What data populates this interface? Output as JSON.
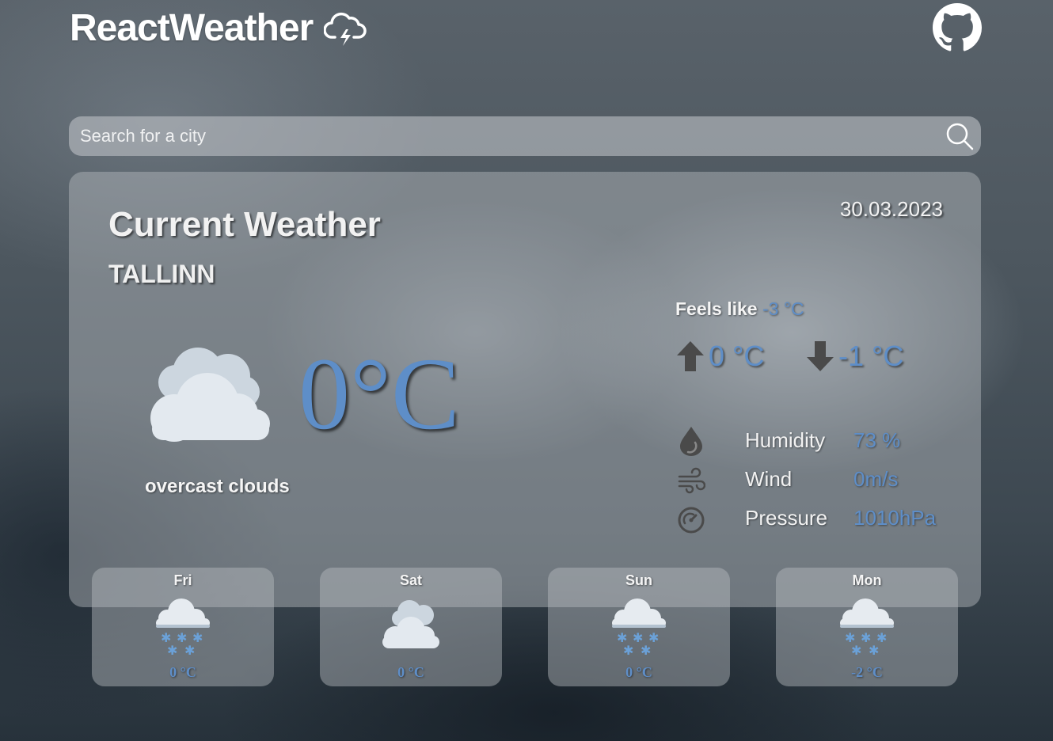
{
  "header": {
    "title": "ReactWeather",
    "logo_icon": "cloud-lightning-icon",
    "github_icon": "github-icon"
  },
  "search": {
    "placeholder": "Search for a city",
    "value": ""
  },
  "current": {
    "heading": "Current Weather",
    "date": "30.03.2023",
    "city": "TALLINN",
    "temperature": "0°C",
    "description": "overcast clouds",
    "icon": "overcast-clouds-icon",
    "feels_like_label": "Feels like",
    "feels_like_value": "-3 °C",
    "temp_max": "0 °C",
    "temp_min": "-1 °C",
    "details": [
      {
        "icon": "humidity-drop-icon",
        "label": "Humidity",
        "value": "73 %"
      },
      {
        "icon": "wind-icon",
        "label": "Wind",
        "value": "0m/s"
      },
      {
        "icon": "pressure-gauge-icon",
        "label": "Pressure",
        "value": "1010hPa"
      }
    ]
  },
  "forecast": [
    {
      "day": "Fri",
      "icon": "snow-icon",
      "temp": "0 °C"
    },
    {
      "day": "Sat",
      "icon": "overcast-clouds-icon",
      "temp": "0 °C"
    },
    {
      "day": "Sun",
      "icon": "snow-icon",
      "temp": "0 °C"
    },
    {
      "day": "Mon",
      "icon": "snow-icon",
      "temp": "-2 °C"
    }
  ],
  "colors": {
    "accent": "#5e8ec8",
    "card": "#b9bcc0"
  }
}
